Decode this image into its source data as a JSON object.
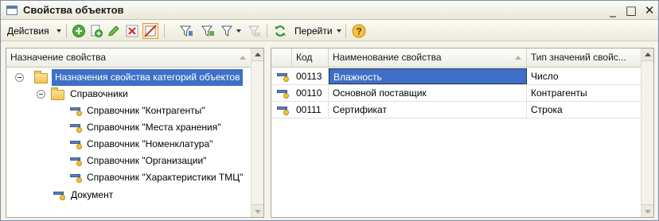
{
  "window": {
    "title": "Свойства объектов",
    "controls": [
      "_",
      "□",
      "✕"
    ]
  },
  "toolbar": {
    "actions_label": "Действия",
    "goto_label": "Перейти",
    "icons": [
      "add-icon",
      "copy-icon",
      "edit-icon",
      "delete-icon",
      "mark-delete-icon",
      "filter-icon",
      "filter-value-icon",
      "filter-dropdown-icon",
      "filter-clear-icon",
      "refresh-icon",
      "help-icon"
    ]
  },
  "tree": {
    "header": "Назначение свойства",
    "items": [
      {
        "label": "Назначения свойства категорий объектов",
        "level": 0,
        "kind": "folder",
        "expanded": true,
        "selected": true
      },
      {
        "label": "Справочники",
        "level": 1,
        "kind": "folder",
        "expanded": true
      },
      {
        "label": "Справочник \"Контрагенты\"",
        "level": 2,
        "kind": "property"
      },
      {
        "label": "Справочник \"Места хранения\"",
        "level": 2,
        "kind": "property"
      },
      {
        "label": "Справочник \"Номенклатура\"",
        "level": 2,
        "kind": "property"
      },
      {
        "label": "Справочник \"Организации\"",
        "level": 2,
        "kind": "property"
      },
      {
        "label": "Справочник \"Характеристики ТМЦ\"",
        "level": 2,
        "kind": "property"
      },
      {
        "label": "Документ",
        "level": 1,
        "kind": "property"
      }
    ]
  },
  "table": {
    "columns": [
      "Код",
      "Наименование свойства",
      "Тип значений свойс..."
    ],
    "rows": [
      {
        "code": "00113",
        "name": "Влажность",
        "type": "Число"
      },
      {
        "code": "00110",
        "name": "Основной поставщик",
        "type": "Контрагенты"
      },
      {
        "code": "00111",
        "name": "Сертификат",
        "type": "Строка"
      }
    ]
  }
}
